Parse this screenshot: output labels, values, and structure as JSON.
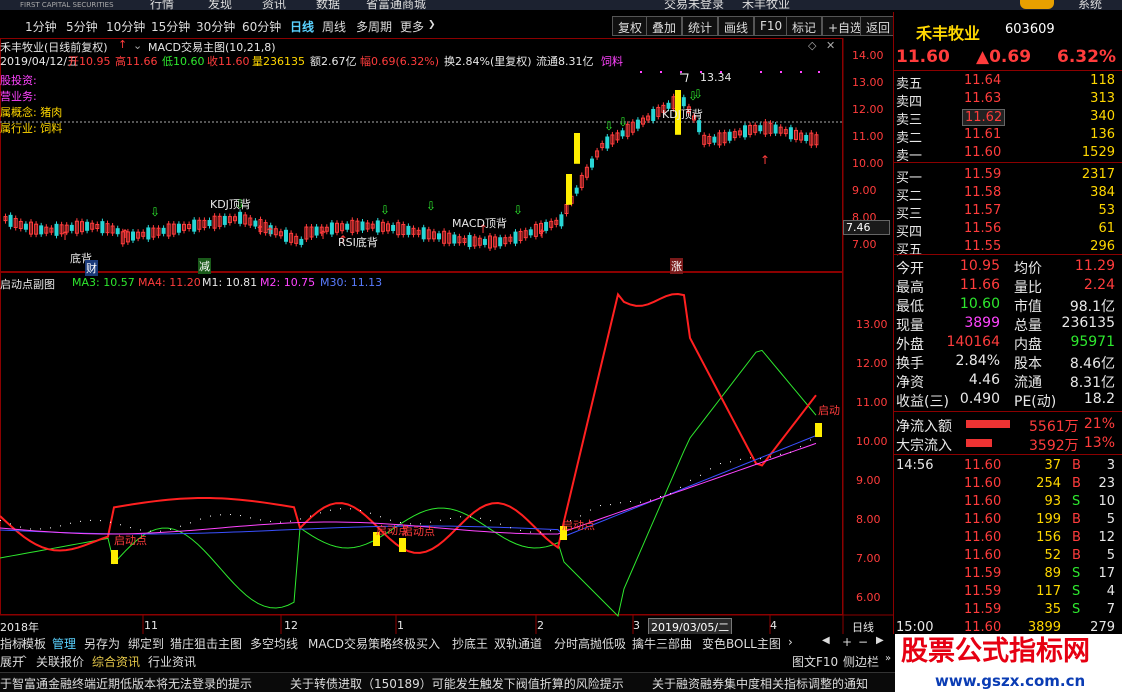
{
  "topbar": {
    "logo": "FIRST CAPITAL SECURITIES",
    "nav1": "行情",
    "nav2": "发现",
    "nav3": "资讯",
    "nav4": "数据",
    "nav5": "省富通商城",
    "login": "交易未登录",
    "stock": "禾丰牧业",
    "system": "系统"
  },
  "toolbar": {
    "periods": [
      "1分钟",
      "5分钟",
      "10分钟",
      "15分钟",
      "30分钟",
      "60分钟",
      "日线",
      "周线",
      "多周期",
      "更多"
    ],
    "right_buttons": [
      "复权",
      "叠加",
      "统计",
      "画线",
      "F10",
      "标记",
      "+自选",
      "返回"
    ],
    "active_period": "日线"
  },
  "main": {
    "title": "禾丰牧业(日线前复权)",
    "indicator": "MACD交易主图(10,21,8)",
    "info_date": "2019/04/12/五",
    "open": "开10.95",
    "high": "高11.66",
    "low": "低10.60",
    "close": "收11.60",
    "volume": "量236135",
    "amount": "额2.67亿",
    "amp": "幅0.69(6.32%)",
    "turnover": "换2.84%(里复权)",
    "float": "流通8.31亿",
    "industry_tag": "饲料",
    "left_notes": [
      "股投资:",
      "营业务:",
      "属概念: 猪肉",
      "属行业: 饲料"
    ],
    "price_axis": [
      "14.00",
      "13.00",
      "12.00",
      "11.00",
      "10.00",
      "9.00",
      "8.00",
      "7.00"
    ],
    "current_price_tag": "7.46",
    "labels": {
      "kdj1": "KDJ顶背",
      "kdj2": "KDJ顶背",
      "rsi": "RSI底背",
      "macd": "MACD顶背",
      "bottom1": "底背",
      "peak": "13.34"
    },
    "markers": {
      "cai": "财",
      "jian": "减",
      "zhang": "涨"
    }
  },
  "sub": {
    "title": "启动点副图",
    "ma3": "MA3: 10.57",
    "ma4": "MA4: 11.20",
    "m1": "M1: 10.81",
    "m2": "M2: 10.75",
    "m30": "M30: 11.13",
    "axis": [
      "13.00",
      "12.00",
      "11.00",
      "10.00",
      "9.00",
      "8.00",
      "7.00",
      "6.00"
    ],
    "labels": [
      "启动点",
      "启动点",
      "启动点",
      "启动点",
      "启动"
    ]
  },
  "xaxis": {
    "labels": [
      "2018年",
      "11",
      "12",
      "1",
      "2",
      "3",
      "2019/03/05/二",
      "4"
    ],
    "period": "日线"
  },
  "right": {
    "name": "禾丰牧业",
    "code": "603609",
    "price": "11.60",
    "change": "▲0.69",
    "pct": "6.32%",
    "asks": [
      {
        "l": "卖五",
        "p": "11.64",
        "v": "118"
      },
      {
        "l": "卖四",
        "p": "11.63",
        "v": "313"
      },
      {
        "l": "卖三",
        "p": "11.62",
        "v": "340"
      },
      {
        "l": "卖二",
        "p": "11.61",
        "v": "136"
      },
      {
        "l": "卖一",
        "p": "11.60",
        "v": "1529"
      }
    ],
    "bids": [
      {
        "l": "买一",
        "p": "11.59",
        "v": "2317"
      },
      {
        "l": "买二",
        "p": "11.58",
        "v": "384"
      },
      {
        "l": "买三",
        "p": "11.57",
        "v": "53"
      },
      {
        "l": "买四",
        "p": "11.56",
        "v": "61"
      },
      {
        "l": "买五",
        "p": "11.55",
        "v": "296"
      }
    ],
    "stats": [
      {
        "a": "今开",
        "av": "10.95",
        "b": "均价",
        "bv": "11.29"
      },
      {
        "a": "最高",
        "av": "11.66",
        "b": "量比",
        "bv": "2.24"
      },
      {
        "a": "最低",
        "av": "10.60",
        "b": "市值",
        "bv": "98.1亿"
      },
      {
        "a": "现量",
        "av": "3899",
        "b": "总量",
        "bv": "236135"
      },
      {
        "a": "外盘",
        "av": "140164",
        "b": "内盘",
        "bv": "95971"
      },
      {
        "a": "换手",
        "av": "2.84%",
        "b": "股本",
        "bv": "8.46亿"
      },
      {
        "a": "净资",
        "av": "4.46",
        "b": "流通",
        "bv": "8.31亿"
      },
      {
        "a": "收益(三)",
        "av": "0.490",
        "b": "PE(动)",
        "bv": "18.2"
      }
    ],
    "flows": [
      {
        "l": "净流入额",
        "v": "5561万",
        "p": "21%"
      },
      {
        "l": "大宗流入",
        "v": "3592万",
        "p": "13%"
      }
    ],
    "ticks": [
      {
        "t": "14:56",
        "p": "11.60",
        "v": "37",
        "s": "B",
        "n": "3"
      },
      {
        "t": "",
        "p": "11.60",
        "v": "254",
        "s": "B",
        "n": "23"
      },
      {
        "t": "",
        "p": "11.60",
        "v": "93",
        "s": "S",
        "n": "10"
      },
      {
        "t": "",
        "p": "11.60",
        "v": "199",
        "s": "B",
        "n": "5"
      },
      {
        "t": "",
        "p": "11.60",
        "v": "156",
        "s": "B",
        "n": "12"
      },
      {
        "t": "",
        "p": "11.60",
        "v": "52",
        "s": "B",
        "n": "5"
      },
      {
        "t": "",
        "p": "11.59",
        "v": "89",
        "s": "S",
        "n": "17"
      },
      {
        "t": "",
        "p": "11.59",
        "v": "117",
        "s": "S",
        "n": "4"
      },
      {
        "t": "",
        "p": "11.59",
        "v": "35",
        "s": "S",
        "n": "7"
      },
      {
        "t": "15:00",
        "p": "11.60",
        "v": "3899",
        "s": "",
        "n": "279"
      }
    ]
  },
  "bottom_tabs": [
    "指标",
    "模板",
    "管理",
    "另存为",
    "绑定到",
    "猎庄狙击主图",
    "多空均线",
    "MACD交易策略",
    "终极买入",
    "抄底王",
    "双轨通道",
    "分时高抛低吸",
    "擒牛三部曲",
    "变色BOLL主图"
  ],
  "bottom_tabs2": [
    "展开",
    "关联报价",
    "综合资讯",
    "行业资讯"
  ],
  "bottom_right": [
    "图文F10",
    "侧边栏"
  ],
  "ticker": [
    "于智富通金融终端近期低版本将无法登录的提示",
    "关于转债进取（150189）可能发生触发下阀值折算的风险提示",
    "关于融资融券集中度相关指标调整的通知"
  ],
  "watermark": {
    "cn": "股票公式指标网",
    "url": "www.gszx.com.cn"
  }
}
